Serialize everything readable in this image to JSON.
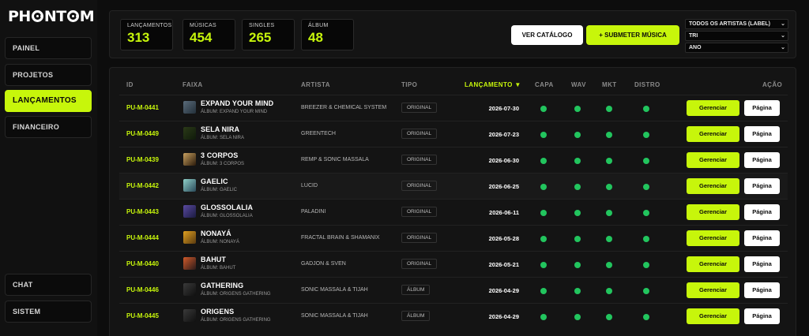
{
  "app": {
    "logo_text": "PHANTOM"
  },
  "sidebar": {
    "items": [
      {
        "label": "PAINEL",
        "active": false
      },
      {
        "label": "PROJETOS",
        "active": false
      },
      {
        "label": "LANÇAMENTOS",
        "active": true
      },
      {
        "label": "FINANCEIRO",
        "active": false
      }
    ],
    "bottom_items": [
      {
        "label": "CHAT"
      },
      {
        "label": "SISTEM"
      }
    ]
  },
  "stats": [
    {
      "label": "Lançamentos",
      "value": "313"
    },
    {
      "label": "Músicas",
      "value": "454"
    },
    {
      "label": "Singles",
      "value": "265"
    },
    {
      "label": "Álbum",
      "value": "48"
    }
  ],
  "actions": {
    "catalog_label": "VER CATÁLOGO",
    "submit_label": "+ SUBMETER MÚSICA"
  },
  "filters": [
    {
      "value": "TODOS OS ARTISTAS (LABEL)"
    },
    {
      "value": "TRI"
    },
    {
      "value": "ANO"
    }
  ],
  "table": {
    "headers": {
      "id": "ID",
      "track": "FAIXA",
      "artist": "ARTISTA",
      "type": "TIPO",
      "release": "LANÇAMENTO ▼",
      "cover": "CAPA",
      "wav": "WAV",
      "mkt": "MKT",
      "distro": "DISTRO",
      "action": "AÇÃO"
    },
    "manage_label": "Gerenciar",
    "page_label": "Página",
    "rows": [
      {
        "id": "PU-M-0441",
        "title": "EXPAND YOUR MIND",
        "album": "ÁLBUM: EXPAND YOUR MIND",
        "artist": "BREEZER & CHEMICAL SYSTEM",
        "type": "ORIGINAL",
        "date": "2026-07-30"
      },
      {
        "id": "PU-M-0449",
        "title": "SELA NIRA",
        "album": "ÁLBUM: SELA NIRA",
        "artist": "GREENTECH",
        "type": "ORIGINAL",
        "date": "2026-07-23"
      },
      {
        "id": "PU-M-0439",
        "title": "3 CORPOS",
        "album": "ÁLBUM: 3 CORPOS",
        "artist": "REMP & SONIC MASSALA",
        "type": "ORIGINAL",
        "date": "2026-06-30"
      },
      {
        "id": "PU-M-0442",
        "title": "GAELIC",
        "album": "ÁLBUM: GAELIC",
        "artist": "LUCID",
        "type": "ORIGINAL",
        "date": "2026-06-25"
      },
      {
        "id": "PU-M-0443",
        "title": "GLOSSOLALIA",
        "album": "ÁLBUM: GLOSSOLALIA",
        "artist": "PALADINI",
        "type": "ORIGINAL",
        "date": "2026-06-11"
      },
      {
        "id": "PU-M-0444",
        "title": "NONAYÁ",
        "album": "ÁLBUM: NONAYÁ",
        "artist": "FRACTAL BRAIN & SHAMANIX",
        "type": "ORIGINAL",
        "date": "2026-05-28"
      },
      {
        "id": "PU-M-0440",
        "title": "BAHUT",
        "album": "ÁLBUM: BAHUT",
        "artist": "GADJON & SVEN",
        "type": "ORIGINAL",
        "date": "2026-05-21"
      },
      {
        "id": "PU-M-0446",
        "title": "GATHERING",
        "album": "ÁLBUM: ORIGENS GATHERING",
        "artist": "SONIC MASSALA & TIJAH",
        "type": "ÁLBUM",
        "date": "2026-04-29"
      },
      {
        "id": "PU-M-0445",
        "title": "ORIGENS",
        "album": "ÁLBUM: ORIGENS GATHERING",
        "artist": "SONIC MASSALA & TIJAH",
        "type": "ÁLBUM",
        "date": "2026-04-29"
      }
    ]
  },
  "colors": {
    "accent": "#c7f60b",
    "status_ok": "#22c55e",
    "background": "#0d0d0d"
  }
}
